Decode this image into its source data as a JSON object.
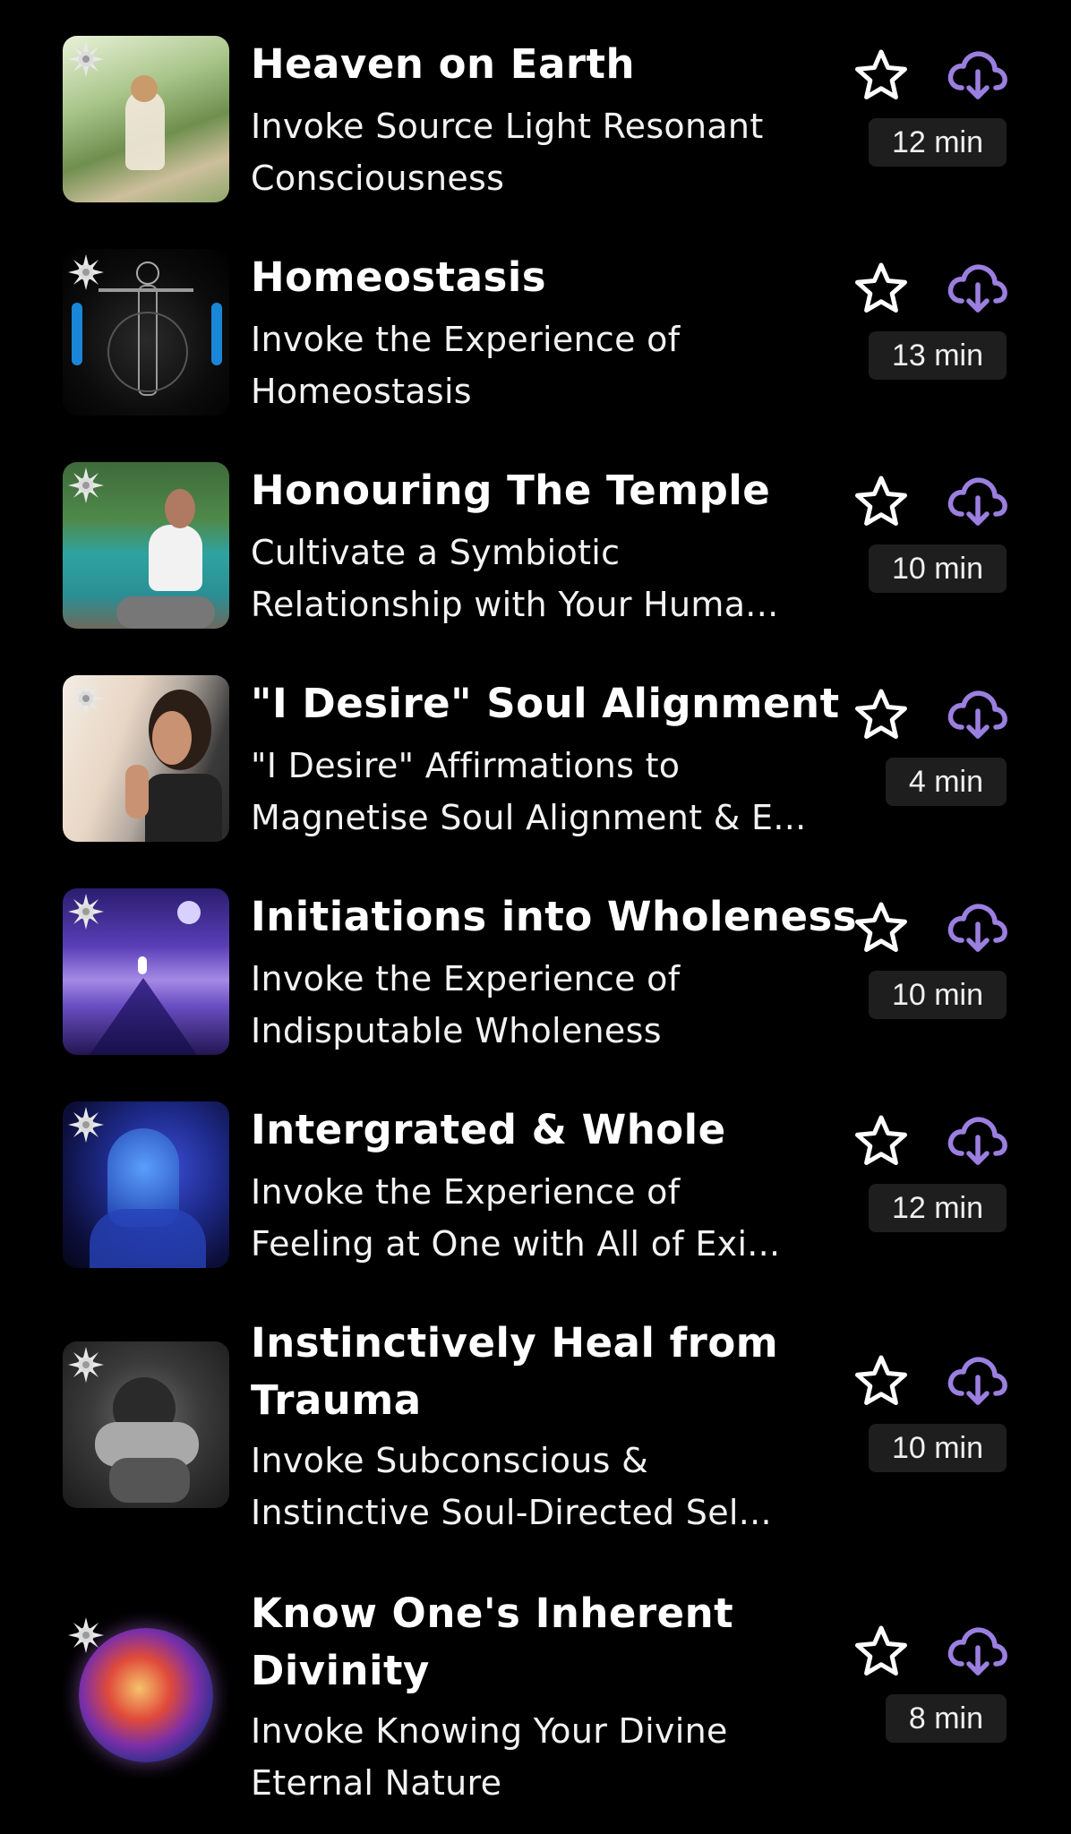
{
  "accent_color": "#9b7fe0",
  "items": [
    {
      "title": "Heaven on Earth",
      "subtitle_line1": "Invoke Source Light Resonant",
      "subtitle_line2": "Consciousness",
      "duration": "12 min"
    },
    {
      "title": "Homeostasis",
      "subtitle_line1": "Invoke the Experience of",
      "subtitle_line2": "Homeostasis",
      "duration": "13 min"
    },
    {
      "title": "Honouring The Temple",
      "subtitle_line1": "Cultivate a Symbiotic",
      "subtitle_line2": "Relationship with Your Huma...",
      "duration": "10 min"
    },
    {
      "title": "\"I Desire\" Soul Alignment",
      "subtitle_line1": "\"I Desire\" Affirmations to",
      "subtitle_line2": "Magnetise Soul Alignment & E...",
      "duration": "4 min"
    },
    {
      "title": "Initiations into Wholeness",
      "subtitle_line1": "Invoke the Experience of",
      "subtitle_line2": "Indisputable Wholeness",
      "duration": "10 min"
    },
    {
      "title": "Intergrated & Whole",
      "subtitle_line1": "Invoke the Experience of",
      "subtitle_line2": "Feeling at One with All of Exi...",
      "duration": "12 min"
    },
    {
      "title_line1": "Instinctively Heal from",
      "title_line2": "Trauma",
      "subtitle_line1": "Invoke Subconscious &",
      "subtitle_line2": "Instinctive Soul-Directed Sel...",
      "duration": "10 min"
    },
    {
      "title_line1": "Know One's Inherent",
      "title_line2": "Divinity",
      "subtitle_line1": "Invoke Knowing Your Divine",
      "subtitle_line2": "Eternal Nature",
      "duration": "8 min"
    }
  ]
}
